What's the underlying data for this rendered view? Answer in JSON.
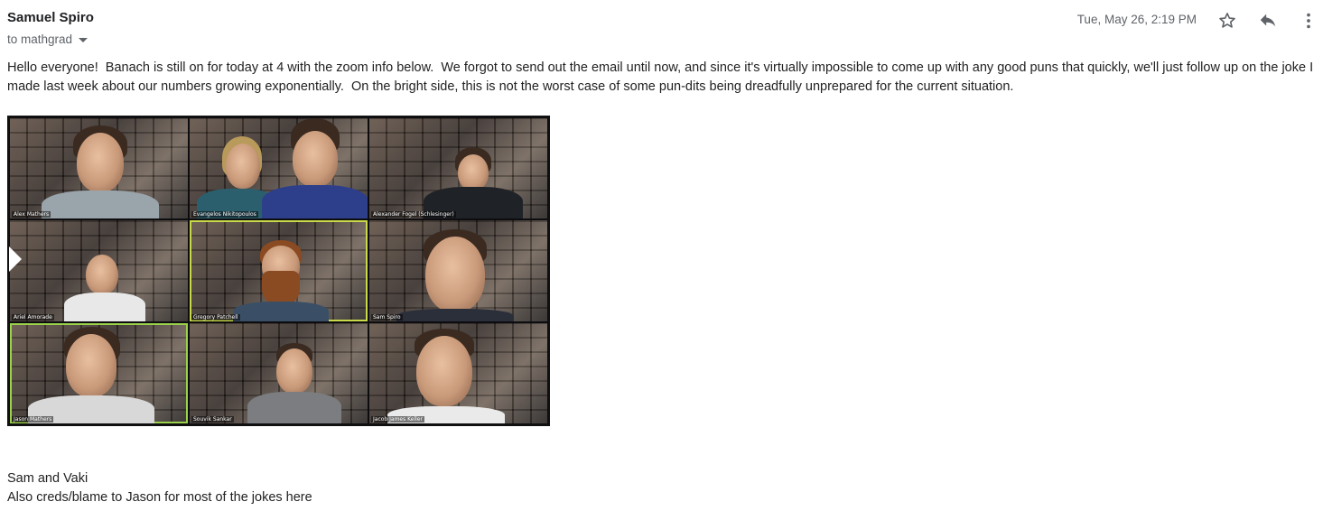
{
  "email": {
    "sender": "Samuel Spiro",
    "recipient": "to mathgrad",
    "date": "Tue, May 26, 2:19 PM",
    "body": "Hello everyone!  Banach is still on for today at 4 with the zoom info below.  We forgot to send out the email until now, and since it's virtually impossible to come up with any good puns that quickly, we'll just follow up on the joke I made last week about our numbers growing exponentially.  On the bright side, this is not the worst case of some pun-dits being dreadfully unprepared for the current situation.",
    "signature_line1": "Sam and Vaki",
    "signature_line2": "Also creds/blame to Jason for most of the jokes here"
  },
  "actions": {
    "star": "star-icon",
    "reply": "reply-icon",
    "more": "more-vertical-icon"
  },
  "photo": {
    "tiles": [
      {
        "name": "Alex Mathers"
      },
      {
        "name": "Evangelos Nikitopoulos"
      },
      {
        "name": "Alexander Fogel (Schlesinger)"
      },
      {
        "name": "Ariel Amorade"
      },
      {
        "name": "Gregory Patchell"
      },
      {
        "name": "Sam Spiro"
      },
      {
        "name": "Jason Mathers"
      },
      {
        "name": "Souvik Sankar"
      },
      {
        "name": "Jacob James Keller"
      }
    ]
  },
  "colors": {
    "sender_text": "#202124",
    "meta_text": "#5f6368",
    "body_text": "#222222",
    "highlight_tile": "#c9d94a"
  }
}
